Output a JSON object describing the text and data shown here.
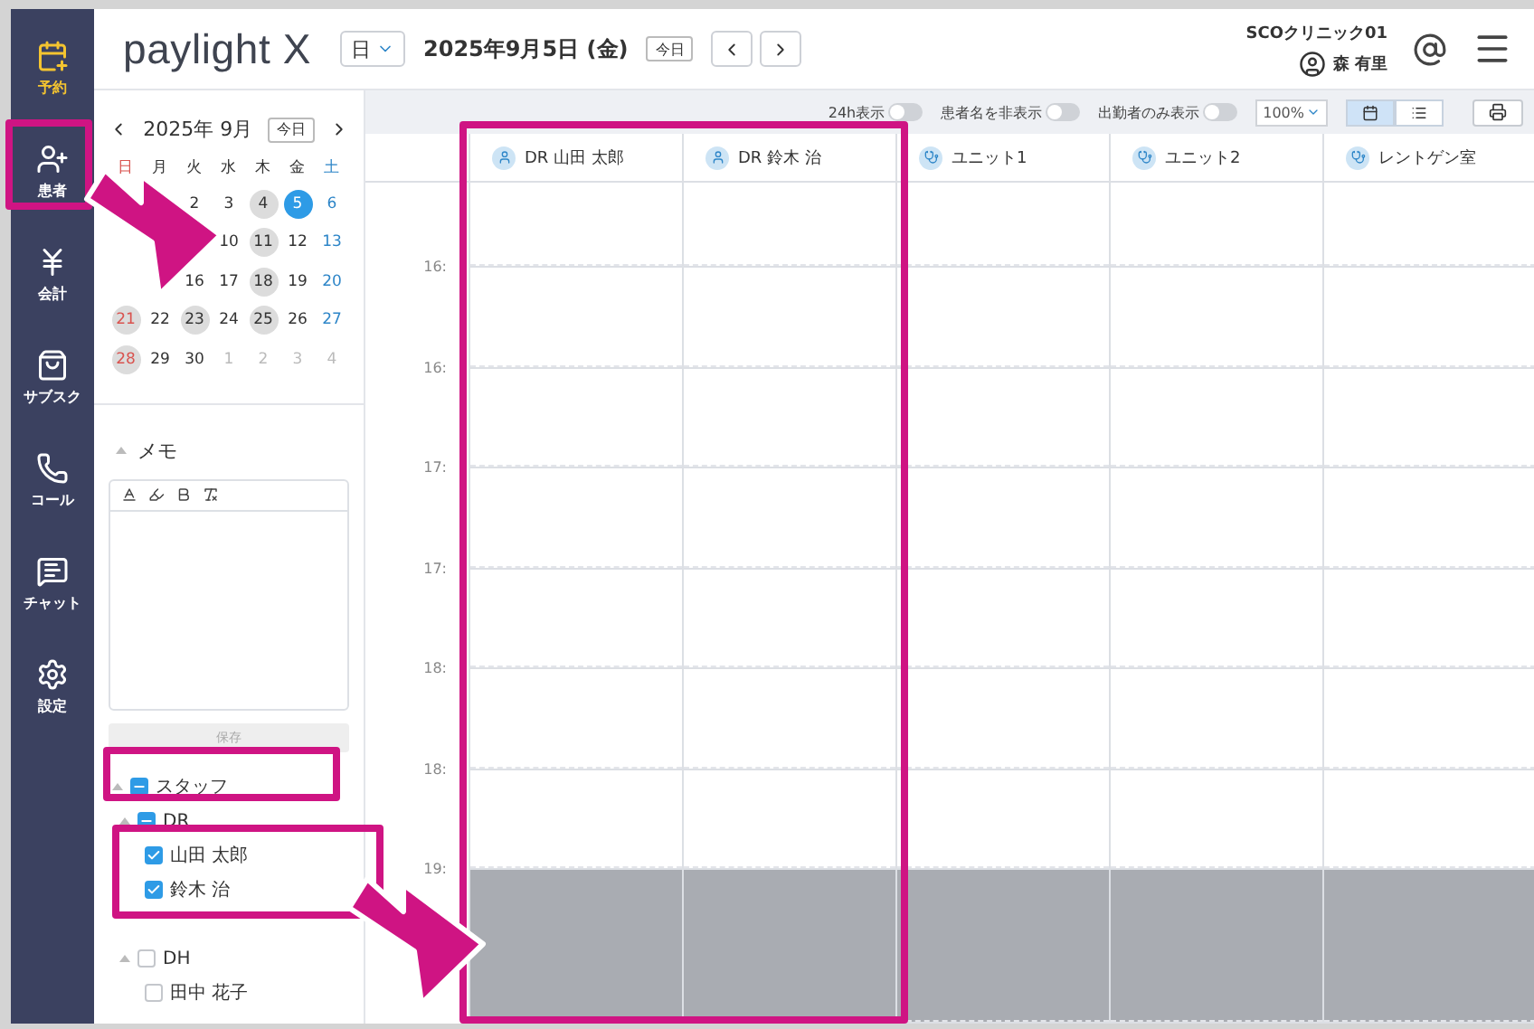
{
  "sidebar": {
    "items": [
      {
        "label": "予約",
        "selected": true
      },
      {
        "label": "患者",
        "selected": false
      },
      {
        "label": "会計",
        "selected": false
      },
      {
        "label": "サブスク",
        "selected": false
      },
      {
        "label": "コール",
        "selected": false
      },
      {
        "label": "チャット",
        "selected": false
      },
      {
        "label": "設定",
        "selected": false
      }
    ]
  },
  "header": {
    "logo": "paylight X",
    "view_select": "日",
    "date": "2025年9月5日 (金)",
    "today_button": "今日",
    "clinic": "SCOクリニック01",
    "user": "森 有里"
  },
  "calendar": {
    "month": "2025年 9月",
    "today_button": "今日",
    "weekdays": [
      "日",
      "月",
      "火",
      "水",
      "木",
      "金",
      "土"
    ],
    "weeks": [
      [
        {
          "label": "2",
          "closed": false,
          "selected": false,
          "other_month": false
        },
        {
          "label": "3",
          "closed": false,
          "selected": false,
          "other_month": false
        },
        {
          "label": "4",
          "closed": true,
          "selected": false,
          "other_month": false
        },
        {
          "label": "5",
          "closed": false,
          "selected": true,
          "other_month": false
        },
        {
          "label": "6",
          "closed": false,
          "selected": false,
          "other_month": false
        }
      ],
      [
        {
          "label": "10",
          "closed": false,
          "selected": false,
          "other_month": false
        },
        {
          "label": "11",
          "closed": true,
          "selected": false,
          "other_month": false
        },
        {
          "label": "12",
          "closed": false,
          "selected": false,
          "other_month": false
        },
        {
          "label": "13",
          "closed": false,
          "selected": false,
          "other_month": false
        }
      ],
      [
        {
          "label": "16",
          "closed": false,
          "selected": false,
          "other_month": false
        },
        {
          "label": "17",
          "closed": false,
          "selected": false,
          "other_month": false
        },
        {
          "label": "18",
          "closed": true,
          "selected": false,
          "other_month": false
        },
        {
          "label": "19",
          "closed": false,
          "selected": false,
          "other_month": false
        },
        {
          "label": "20",
          "closed": false,
          "selected": false,
          "other_month": false
        }
      ],
      [
        {
          "label": "21",
          "closed": true,
          "selected": false,
          "other_month": false
        },
        {
          "label": "22",
          "closed": false,
          "selected": false,
          "other_month": false
        },
        {
          "label": "23",
          "closed": true,
          "selected": false,
          "other_month": false
        },
        {
          "label": "24",
          "closed": false,
          "selected": false,
          "other_month": false
        },
        {
          "label": "25",
          "closed": true,
          "selected": false,
          "other_month": false
        },
        {
          "label": "26",
          "closed": false,
          "selected": false,
          "other_month": false
        },
        {
          "label": "27",
          "closed": false,
          "selected": false,
          "other_month": false
        }
      ],
      [
        {
          "label": "28",
          "closed": true,
          "selected": false,
          "other_month": false
        },
        {
          "label": "29",
          "closed": false,
          "selected": false,
          "other_month": false
        },
        {
          "label": "30",
          "closed": false,
          "selected": false,
          "other_month": false
        },
        {
          "label": "1",
          "closed": false,
          "selected": false,
          "other_month": true
        },
        {
          "label": "2",
          "closed": false,
          "selected": false,
          "other_month": true
        },
        {
          "label": "3",
          "closed": false,
          "selected": false,
          "other_month": true
        },
        {
          "label": "4",
          "closed": false,
          "selected": false,
          "other_month": true
        }
      ]
    ]
  },
  "memo": {
    "title": "メモ",
    "expanded": true,
    "save_button": "保存",
    "save_disabled": true
  },
  "staff_tree": {
    "label": "スタッフ",
    "expanded": true,
    "checked": false,
    "partial": true,
    "children": [
      {
        "label": "DR",
        "expanded": true,
        "checked": false,
        "partial": true,
        "children": [
          {
            "label": "山田 太郎",
            "checked": true
          },
          {
            "label": "鈴木 治",
            "checked": true
          }
        ]
      },
      {
        "label": "DH",
        "expanded": true,
        "checked": false,
        "partial": false,
        "children": [
          {
            "label": "田中 花子",
            "checked": false
          }
        ]
      }
    ]
  },
  "toolbar": {
    "toggles": [
      {
        "label": "24h表示",
        "on": false
      },
      {
        "label": "患者名を非表示",
        "on": false
      },
      {
        "label": "出勤者のみ表示",
        "on": false
      }
    ],
    "zoom": "100%",
    "views": [
      {
        "selected": true
      },
      {
        "selected": false
      }
    ]
  },
  "columns": [
    {
      "label": "DR 山田 太郎",
      "kind": "staff"
    },
    {
      "label": "DR 鈴木 治",
      "kind": "staff"
    },
    {
      "label": "ユニット1",
      "kind": "unit"
    },
    {
      "label": "ユニット2",
      "kind": "unit"
    },
    {
      "label": "レントゲン室",
      "kind": "unit"
    }
  ],
  "time_rows": [
    {
      "kind": "open"
    },
    {
      "time": "16:",
      "kind": "open"
    },
    {
      "time": "16:",
      "kind": "open"
    },
    {
      "time": "17:",
      "kind": "open"
    },
    {
      "time": "17:",
      "kind": "open"
    },
    {
      "time": "18:",
      "kind": "open"
    },
    {
      "time": "18:",
      "kind": "open"
    },
    {
      "time": "19:",
      "kind": "closed"
    }
  ]
}
